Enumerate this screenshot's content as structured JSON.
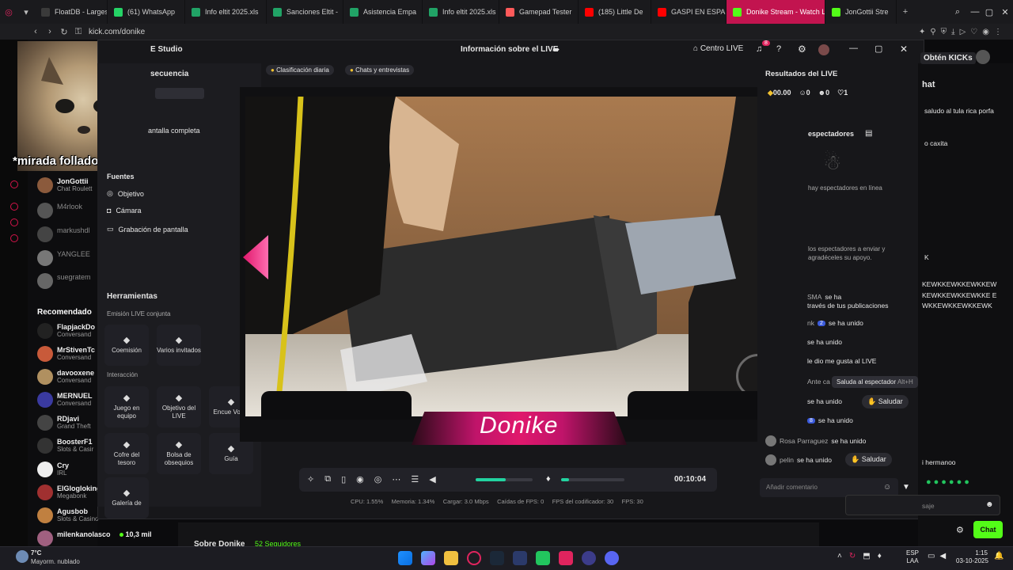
{
  "colors": {
    "kick_green": "#53fc18",
    "accent_pink": "#e0186c",
    "tab_active": "#c2144f"
  },
  "tabs": [
    {
      "label": "FloatDB - Largest",
      "icon": "floatdb-icon",
      "color": "#3a3a3a"
    },
    {
      "label": "(61) WhatsApp",
      "icon": "whatsapp-icon",
      "color": "#25d366"
    },
    {
      "label": "Info eltit 2025.xls",
      "icon": "sheets-icon",
      "color": "#21a366"
    },
    {
      "label": "Sanciones Eltit -",
      "icon": "sheets-icon",
      "color": "#21a366"
    },
    {
      "label": "Asistencia Empa",
      "icon": "sheets-icon",
      "color": "#21a366"
    },
    {
      "label": "Info eltit 2025.xls",
      "icon": "sheets-icon",
      "color": "#21a366"
    },
    {
      "label": "Gamepad Tester",
      "icon": "gamepad-icon",
      "color": "#ff5a5a"
    },
    {
      "label": "(185) Little De",
      "icon": "youtube-icon",
      "color": "#ff0000"
    },
    {
      "label": "GASPI EN ESPAÑ",
      "icon": "youtube-icon",
      "color": "#ff0000"
    },
    {
      "label": "Donike Stream - Watch L",
      "icon": "kick-icon",
      "color": "#53fc18"
    },
    {
      "label": "JonGottii Stre",
      "icon": "kick-icon",
      "color": "#53fc18"
    }
  ],
  "url": "kick.com/donike",
  "cam_overlay": "*mirada folladora*",
  "studio": {
    "title": "E Studio",
    "live_info": "Información sobre el LIVE",
    "centro_live": "Centro LIVE",
    "notif_count": "8",
    "secuencia": "secuencia",
    "pantalla": "antalla completa",
    "fuentes": "Fuentes",
    "sources": [
      "Objetivo",
      "Cámara",
      "Grabación de pantalla"
    ],
    "herramientas": "Herramientas",
    "emision": "Emisión LIVE conjunta",
    "interaccion": "Interacción",
    "tools_row1": [
      {
        "label": "Coemisión",
        "icon": "link-icon"
      },
      {
        "label": "Varios invitados",
        "icon": "users-icon"
      }
    ],
    "tools_row2": [
      {
        "label": "Juego en equipo",
        "icon": "team-icon"
      },
      {
        "label": "Objetivo del LIVE",
        "icon": "target-icon"
      },
      {
        "label": "Encue Votac",
        "icon": "poll-icon"
      }
    ],
    "tools_row3": [
      {
        "label": "Cofre del tesoro",
        "icon": "chest-icon"
      },
      {
        "label": "Bolsa de obsequios",
        "icon": "gift-bag-icon"
      },
      {
        "label": "Guía",
        "icon": "guide-icon"
      }
    ],
    "tools_row4": [
      {
        "label": "Galería de",
        "icon": "gallery-icon"
      }
    ],
    "tab_ranking": "Clasificación diaria",
    "tab_chats": "Chats y entrevistas",
    "streamer_name": "Donike",
    "timer": "00:10:04",
    "stats": "CPU: 1.55%     Memoria: 1.34%     Cargar: 3.0 Mbps     Caídas de FPS: 0     FPS del codificador: 30     FPS: 30",
    "results_title": "Resultados del LIVE",
    "results": {
      "money": "00.00",
      "viewers": "0",
      "follows": "0",
      "likes": "1"
    },
    "espectadores": "espectadores",
    "no_viewers": "hay espectadores en línea",
    "invite_text": "los espectadores a enviar y agradéceles su apoyo.",
    "activity": [
      {
        "name": "SMA",
        "text": "se ha",
        "extra": "través de tus publicaciones"
      },
      {
        "name": "nk",
        "text": "se ha unido",
        "badge": "2"
      },
      {
        "name": "",
        "text": "se ha unido"
      },
      {
        "name": "",
        "text": "le dio me gusta al LIVE"
      },
      {
        "name": "Ante ca",
        "text": ""
      },
      {
        "name": "",
        "text": "se ha unido"
      },
      {
        "name": "",
        "text": "se ha unido",
        "badge": "8"
      },
      {
        "name": "Rosa Parraguez",
        "text": "se ha unido"
      },
      {
        "name": "pelin",
        "text": "se ha unido"
      }
    ],
    "tooltip": "Saluda al espectador",
    "tooltip_key": "Alt+H",
    "saludar": "Saludar",
    "comment_placeholder": "Añadir comentario",
    "sobre": "Sobre Donike",
    "followers": "52 Seguidores"
  },
  "kick_side": {
    "following": [
      {
        "name": "JonGottii",
        "sub": "Chat Roulett",
        "dim": false,
        "color": "#8b5a3c"
      },
      {
        "name": "M4rlook",
        "sub": "",
        "dim": true,
        "color": "#555"
      },
      {
        "name": "markushdl",
        "sub": "",
        "dim": true,
        "color": "#444"
      },
      {
        "name": "YANGLEE",
        "sub": "",
        "dim": true,
        "color": "#777"
      },
      {
        "name": "suegratem",
        "sub": "",
        "dim": true,
        "color": "#666"
      }
    ],
    "recommended_title": "Recomendado",
    "recommended": [
      {
        "name": "FlapjackDo",
        "sub": "Conversand",
        "color": "#222"
      },
      {
        "name": "MrStivenTc",
        "sub": "Conversand",
        "color": "#c85a3a"
      },
      {
        "name": "davooxene",
        "sub": "Conversand",
        "color": "#b09060"
      },
      {
        "name": "MERNUEL",
        "sub": "Conversand",
        "color": "#3a3aa0"
      },
      {
        "name": "RDjavi",
        "sub": "Grand Theft",
        "color": "#444"
      },
      {
        "name": "BoosterF1",
        "sub": "Slots & Casir",
        "color": "#333"
      },
      {
        "name": "Cry",
        "sub": "IRL",
        "color": "#eee"
      },
      {
        "name": "ElGlogloking",
        "sub": "Megabonk",
        "color": "#a03030"
      },
      {
        "name": "Agusbob",
        "sub": "Slots & Casino",
        "color": "#c08040",
        "viewers": "3,5 mil"
      },
      {
        "name": "milenkanolasco",
        "sub": "",
        "color": "#a06080",
        "viewers": "10,3 mil"
      }
    ]
  },
  "kick_chat": {
    "obtain": "Obtén KICKs",
    "title": "hat",
    "messages": [
      "saludo al tula rica porfa",
      "o caxita",
      "K",
      "KEWKKEWKKEWKKEW KEWKKEWKKEWKKE EWKKEWKKEWKKEWK",
      "i hermanoo"
    ],
    "input_placeholder": "saje",
    "chat_button": "Chat"
  },
  "taskbar": {
    "temp": "7°C",
    "weather": "Mayorm. nublado",
    "lang1": "ESP",
    "lang2": "LAA",
    "time": "1:15",
    "date": "03-10-2025"
  }
}
